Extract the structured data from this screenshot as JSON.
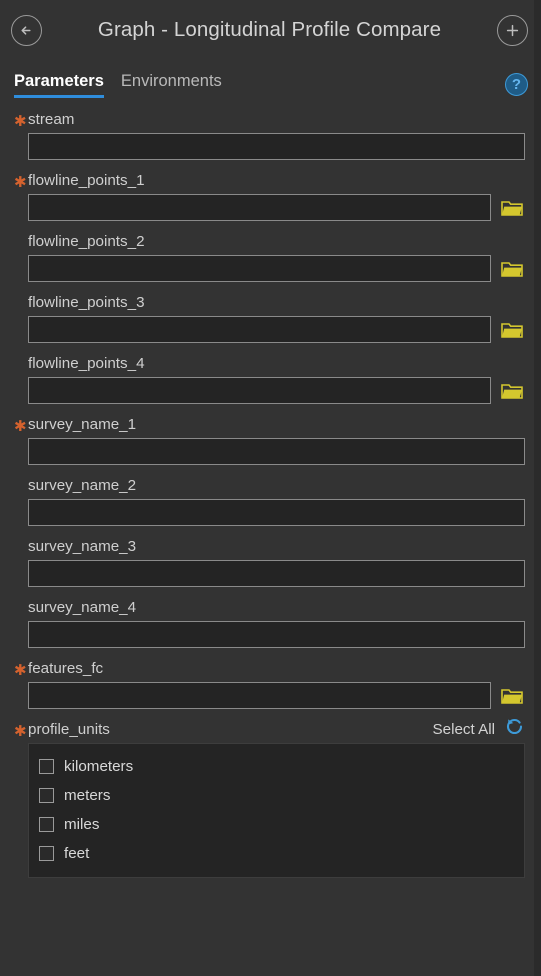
{
  "header": {
    "title": "Graph - Longitudinal Profile Compare",
    "back_icon": "arrow-left-circle-icon",
    "add_icon": "plus-circle-icon"
  },
  "tabs": [
    {
      "label": "Parameters",
      "active": true
    },
    {
      "label": "Environments",
      "active": false
    }
  ],
  "help": {
    "label": "?",
    "icon": "help-circle-icon",
    "color": "#3d9ad8"
  },
  "colors": {
    "pane_background": "#333333",
    "input_background": "#242424",
    "input_border": "#8a8a8a",
    "required_asterisk": "#d4622e",
    "accent_blue": "#2f8ddc",
    "folder_yellow": "#d4c72e",
    "text": "#cfcfcf"
  },
  "fields": [
    {
      "name": "stream",
      "label": "stream",
      "required": true,
      "value": "",
      "placeholder": "",
      "browse": false
    },
    {
      "name": "flowline_points_1",
      "label": "flowline_points_1",
      "required": true,
      "value": "",
      "placeholder": "",
      "browse": true
    },
    {
      "name": "flowline_points_2",
      "label": "flowline_points_2",
      "required": false,
      "value": "",
      "placeholder": "",
      "browse": true
    },
    {
      "name": "flowline_points_3",
      "label": "flowline_points_3",
      "required": false,
      "value": "",
      "placeholder": "",
      "browse": true
    },
    {
      "name": "flowline_points_4",
      "label": "flowline_points_4",
      "required": false,
      "value": "",
      "placeholder": "",
      "browse": true
    },
    {
      "name": "survey_name_1",
      "label": "survey_name_1",
      "required": true,
      "value": "",
      "placeholder": "",
      "browse": false
    },
    {
      "name": "survey_name_2",
      "label": "survey_name_2",
      "required": false,
      "value": "",
      "placeholder": "",
      "browse": false
    },
    {
      "name": "survey_name_3",
      "label": "survey_name_3",
      "required": false,
      "value": "",
      "placeholder": "",
      "browse": false
    },
    {
      "name": "survey_name_4",
      "label": "survey_name_4",
      "required": false,
      "value": "",
      "placeholder": "",
      "browse": false
    },
    {
      "name": "features_fc",
      "label": "features_fc",
      "required": true,
      "value": "",
      "placeholder": "",
      "browse": true
    }
  ],
  "profile_units": {
    "label": "profile_units",
    "required": true,
    "select_all_label": "Select All",
    "reset_icon": "refresh-reset-icon",
    "options": [
      {
        "label": "kilometers",
        "checked": false
      },
      {
        "label": "meters",
        "checked": false
      },
      {
        "label": "miles",
        "checked": false
      },
      {
        "label": "feet",
        "checked": false
      }
    ]
  }
}
